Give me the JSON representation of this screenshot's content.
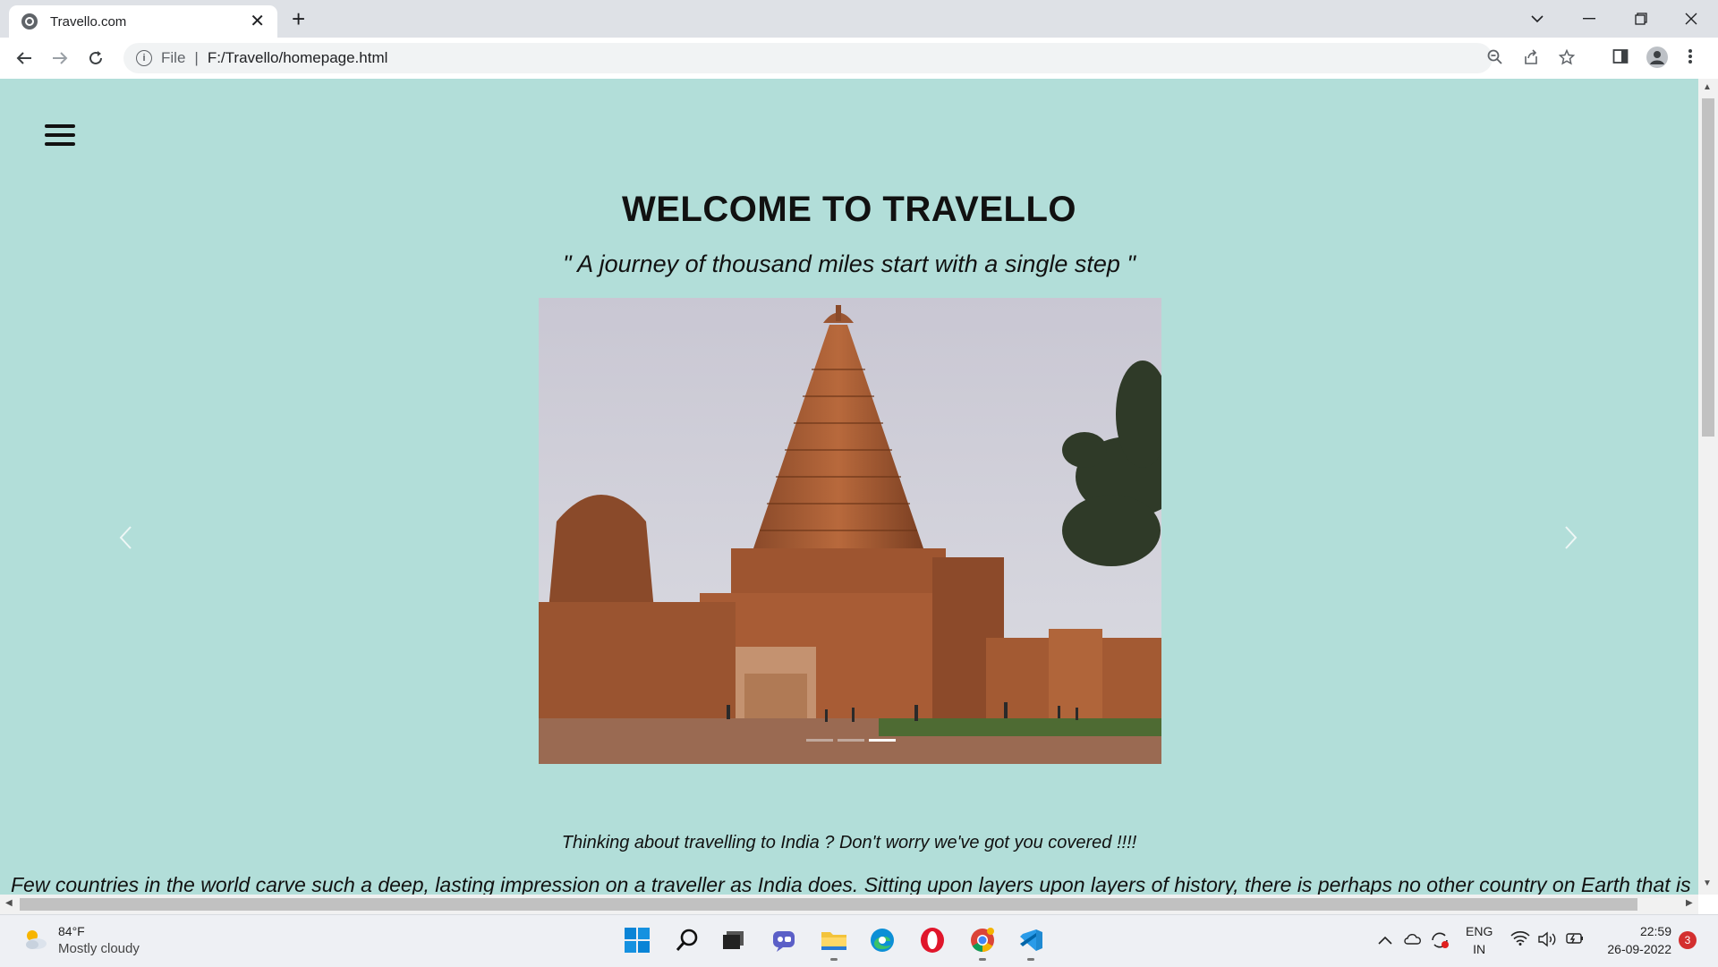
{
  "browser": {
    "tab_title": "Travello.com",
    "tab_close": "✕",
    "new_tab": "+",
    "address_scheme": "File",
    "address_separator": "|",
    "address_url": "F:/Travello/homepage.html"
  },
  "page": {
    "heading": "WELCOME TO TRAVELLO",
    "quote": "\" A journey of thousand miles start with a single step \"",
    "tagline": "Thinking about travelling to India ? Don't worry we've got you covered !!!!",
    "intro": "Few countries in the world carve such a deep, lasting impression on a traveller as India does. Sitting upon layers upon layers of history, there is perhaps no other country on Earth that is",
    "carousel_prev": "‹",
    "carousel_next": "›",
    "carousel_active_index": 3,
    "carousel_slide_count": 3
  },
  "taskbar": {
    "weather_temp": "84°F",
    "weather_desc": "Mostly cloudy",
    "lang_line1": "ENG",
    "lang_line2": "IN",
    "time": "22:59",
    "date": "26-09-2022",
    "notification_count": "3"
  },
  "icons": {
    "favicon": "globe-icon",
    "back": "arrow-left-icon",
    "forward": "arrow-right-icon",
    "reload": "reload-icon",
    "zoom": "zoom-icon",
    "share": "share-icon",
    "bookmark": "star-icon",
    "sidepanel": "side-panel-icon",
    "profile": "profile-icon",
    "menu": "kebab-menu-icon"
  },
  "colors": {
    "page_background": "#b2ded9",
    "chrome_tabstrip": "#dee1e6",
    "notification_badge": "#d32f2f"
  }
}
